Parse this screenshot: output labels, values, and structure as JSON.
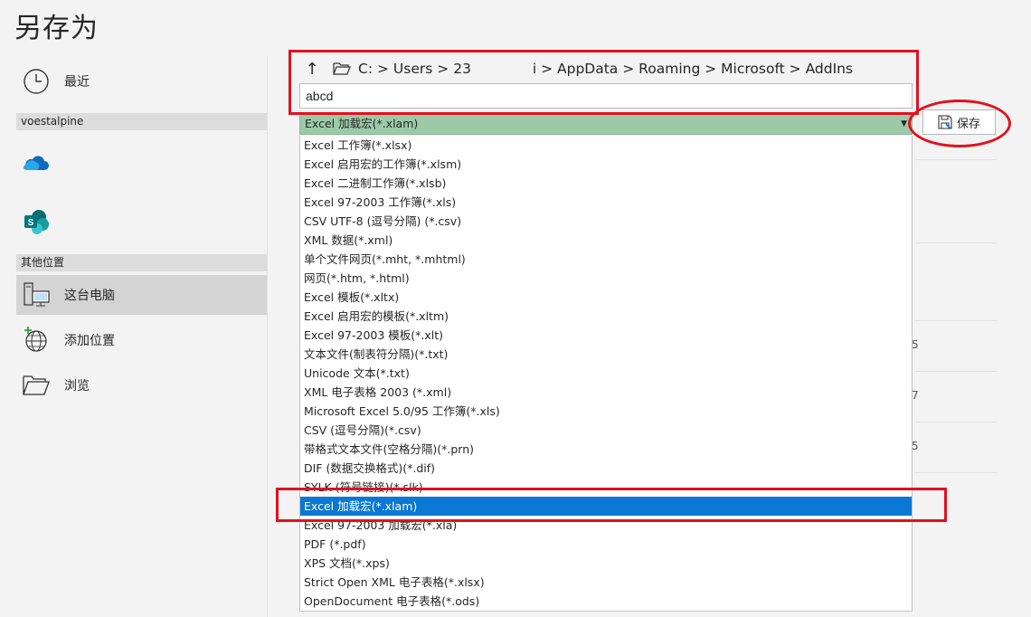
{
  "title": "另存为",
  "nav": {
    "recent": "最近",
    "account_section": "voestalpine",
    "other_section": "其他位置",
    "this_pc": "这台电脑",
    "add_location": "添加位置",
    "browse": "浏览"
  },
  "path": {
    "crumbs": [
      "C:",
      ">",
      "Users",
      ">",
      "23",
      "i",
      ">",
      "AppData",
      ">",
      "Roaming",
      ">",
      "Microsoft",
      ">",
      "AddIns"
    ]
  },
  "filename": "abcd",
  "filetype_selected": "Excel 加载宏(*.xlam)",
  "save_label": "保存",
  "file_types": [
    "Excel 工作簿(*.xlsx)",
    "Excel 启用宏的工作簿(*.xlsm)",
    "Excel 二进制工作簿(*.xlsb)",
    "Excel 97-2003 工作簿(*.xls)",
    "CSV UTF-8 (逗号分隔) (*.csv)",
    "XML 数据(*.xml)",
    "单个文件网页(*.mht, *.mhtml)",
    "网页(*.htm, *.html)",
    "Excel 模板(*.xltx)",
    "Excel 启用宏的模板(*.xltm)",
    "Excel 97-2003 模板(*.xlt)",
    "文本文件(制表符分隔)(*.txt)",
    "Unicode 文本(*.txt)",
    "XML 电子表格 2003 (*.xml)",
    "Microsoft Excel 5.0/95 工作簿(*.xls)",
    "CSV (逗号分隔)(*.csv)",
    "带格式文本文件(空格分隔)(*.prn)",
    "DIF (数据交换格式)(*.dif)",
    "SYLK (符号链接)(*.slk)",
    "Excel 加载宏(*.xlam)",
    "Excel 97-2003 加载宏(*.xla)",
    "PDF (*.pdf)",
    "XPS 文档(*.xps)",
    "Strict Open XML 电子表格(*.xlsx)",
    "OpenDocument 电子表格(*.ods)"
  ],
  "selected_index": 19,
  "background_numbers": [
    "5",
    "7",
    "5"
  ],
  "colors": {
    "filetype_bg": "#9ccaa8",
    "selection": "#0a78d4",
    "annotation_red": "#e0121e"
  }
}
